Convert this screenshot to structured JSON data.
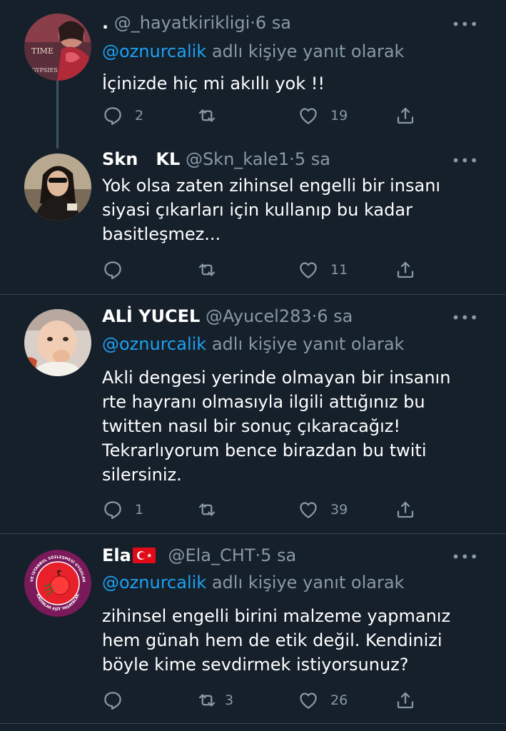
{
  "tweets": [
    {
      "display_name": ".",
      "handle": "@_hayatkirikligi",
      "dot": "·",
      "time": "6 sa",
      "reply_mention": "@oznurcalik",
      "reply_suffix": "adlı kişiye yanıt olarak",
      "text": "İçinizde hiç mi akıllı yok !!",
      "replies": "2",
      "retweets": "",
      "likes": "19",
      "avatar_text": "TIME",
      "avatar_subtext": "GYPSIES"
    },
    {
      "display_name": "Skn   KL",
      "handle": "@Skn_kale1",
      "dot": "·",
      "time": "5 sa",
      "text": "Yok olsa zaten zihinsel engelli bir insanı siyasi çıkarları için kullanıp bu kadar basitleşmez...",
      "replies": "",
      "retweets": "",
      "likes": "11"
    },
    {
      "display_name": "ALİ YUCEL",
      "handle": "@Ayucel283",
      "dot": "·",
      "time": "6 sa",
      "reply_mention": "@oznurcalik",
      "reply_suffix": "adlı kişiye yanıt olarak",
      "text": "Akli dengesi yerinde olmayan bir insanın rte hayranı olmasıyla ilgili attığınız bu twitten nasıl bir sonuç çıkaracağız! Tekrarlıyorum bence birazdan bu twiti silersiniz.",
      "replies": "1",
      "retweets": "",
      "likes": "39"
    },
    {
      "display_name": "Ela",
      "handle": "@Ela_CHT",
      "dot": "·",
      "time": "5 sa",
      "reply_mention": "@oznurcalik",
      "reply_suffix": "adlı kişiye yanıt olarak",
      "text": "zihinsel engelli birini malzeme yapmanız hem günah hem de etik değil. Kendinizi böyle kime sevdirmek istiyorsunuz?",
      "replies": "",
      "retweets": "3",
      "likes": "26",
      "avatar_ring_top": "6284 VE İSTANBUL SÖZLEŞMESİ UYGULANACAK",
      "avatar_ring_bottom": "KADINLAR EŞİT YAŞAYACAK"
    }
  ],
  "more_label": "•••",
  "colors": {
    "background": "#15202b",
    "mention": "#1da1f2",
    "secondary": "#8899a6",
    "divider": "#38444d"
  }
}
